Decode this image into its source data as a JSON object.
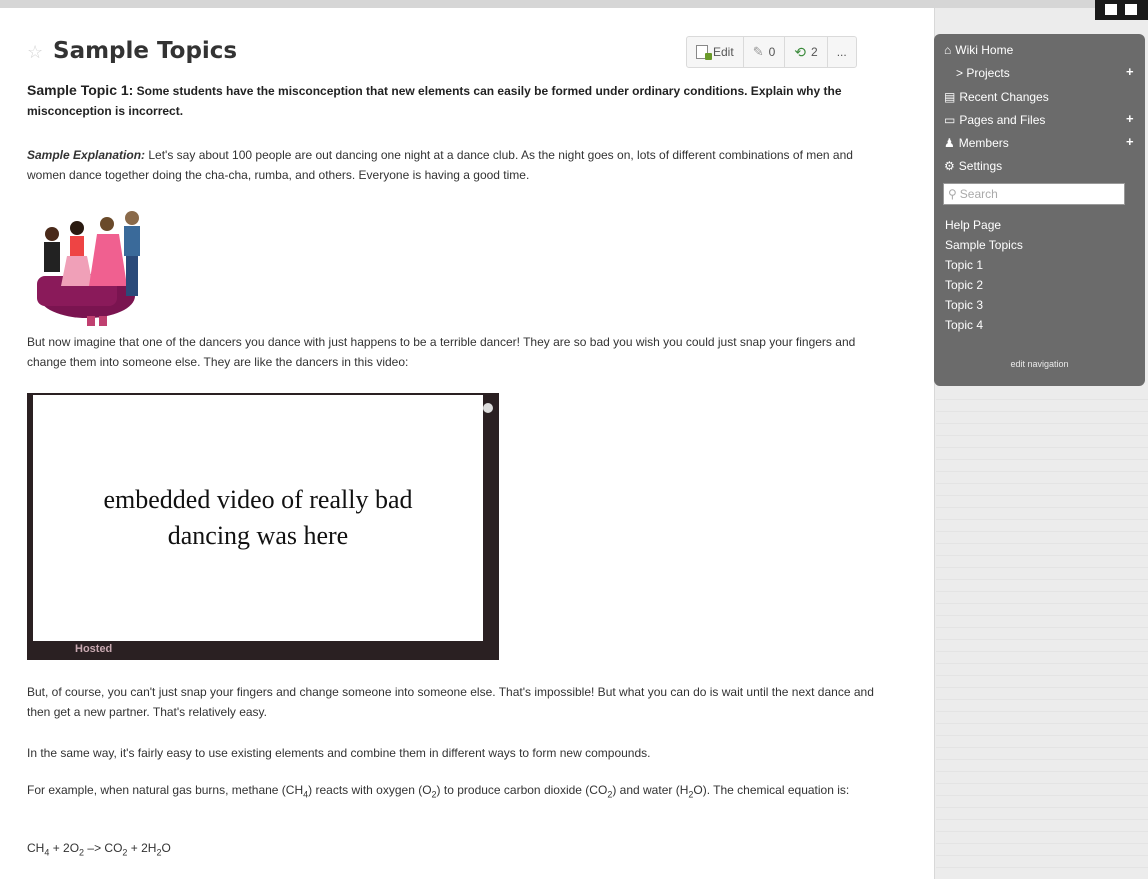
{
  "page": {
    "title": "Sample Topics"
  },
  "toolbar": {
    "edit_label": "Edit",
    "pin_count": "0",
    "revisions_count": "2",
    "more_label": "..."
  },
  "content": {
    "topic_label": "Sample Topic 1:",
    "topic_question": "Some students have the misconception that new elements can easily be formed under ordinary conditions. Explain why the misconception is incorrect.",
    "explanation_label": "Sample Explanation:",
    "explanation_text": "Let's say about 100 people are out dancing one night at a dance club. As the night goes on, lots of different combinations of men and women dance together doing the cha-cha, rumba, and others. Everyone is having a good time.",
    "para_dancer": "But now imagine that one of the dancers you dance with just happens to be a terrible dancer! They are so bad you wish you could just snap your fingers and change them into someone else. They are like the dancers in this video:",
    "video_placeholder_line1": "embedded video of really bad",
    "video_placeholder_line2": "dancing was here",
    "video_hosted": "Hosted",
    "para_snap": "But, of course, you can't just snap your fingers and change someone into someone else. That's impossible! But what you can do is wait until the next dance and then get a new partner. That's relatively easy.",
    "para_same_way": "In the same way, it's fairly easy to use existing elements and combine them in different ways to form new compounds.",
    "para_example_a": "For example, when natural gas burns, methane (CH",
    "para_example_b": ") reacts with oxygen (O",
    "para_example_c": ") to produce carbon dioxide (CO",
    "para_example_d": ") and water (H",
    "para_example_e": "O). The chemical equation is:",
    "sub_4": "4",
    "sub_2": "2",
    "eq_a": "CH",
    "eq_b": " + 2O",
    "eq_c": " –> CO",
    "eq_d": " + 2H",
    "eq_e": "O"
  },
  "sidebar": {
    "wiki_home": "Wiki Home",
    "projects": "> Projects",
    "recent_changes": "Recent Changes",
    "pages_and_files": "Pages and Files",
    "members": "Members",
    "settings": "Settings",
    "search_placeholder": "Search",
    "nav_links": [
      "Help Page",
      "Sample Topics",
      "Topic 1",
      "Topic 2",
      "Topic 3",
      "Topic 4"
    ],
    "edit_navigation": "edit navigation",
    "plus": "+"
  }
}
